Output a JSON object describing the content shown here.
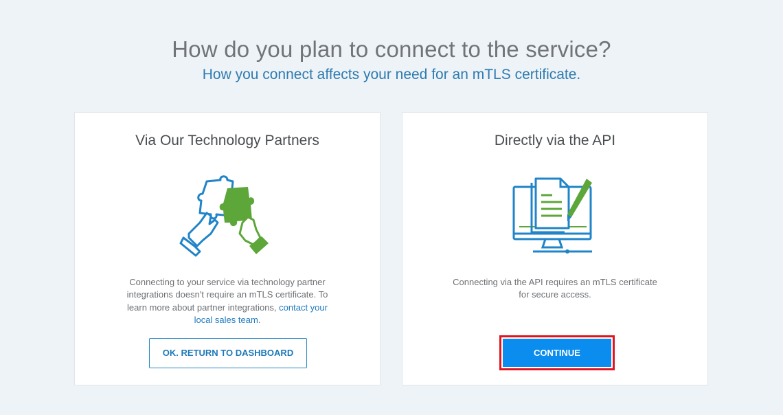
{
  "header": {
    "title": "How do you plan to connect to the service?",
    "subtitle": "How you connect affects your need for an mTLS certificate."
  },
  "cards": {
    "partners": {
      "title": "Via Our Technology Partners",
      "description": "Connecting to your service via technology partner integrations doesn't require an mTLS certificate. To learn more about partner integrations, ",
      "link_text": "contact your local sales team",
      "description_end": ".",
      "button_label": "OK. RETURN TO DASHBOARD",
      "icon": "puzzle-hands-icon"
    },
    "api": {
      "title": "Directly via the API",
      "description": "Connecting via the API requires an mTLS certificate for secure access.",
      "button_label": "CONTINUE",
      "icon": "computer-document-pen-icon"
    }
  },
  "colors": {
    "background": "#eef3f7",
    "blue_accent": "#1f7bc2",
    "green_accent": "#5da63a",
    "primary_button": "#0b8def",
    "highlight_border": "#e0141e"
  }
}
